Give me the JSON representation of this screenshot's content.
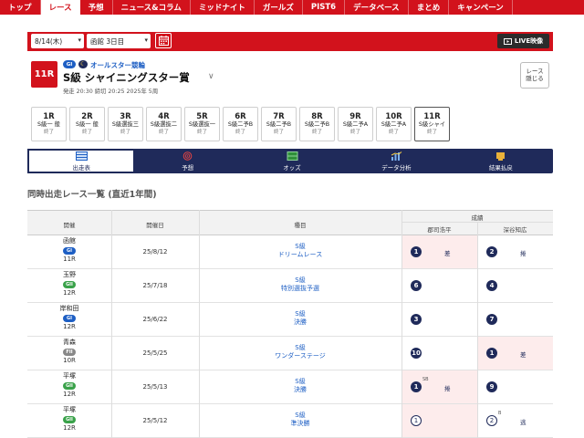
{
  "nav": {
    "items": [
      "トップ",
      "レース",
      "予想",
      "ニュース&コラム",
      "ミッドナイト",
      "ガールズ",
      "PIST6",
      "データベース",
      "まとめ",
      "キャンペーン"
    ],
    "active_index": 1
  },
  "toolbar": {
    "date_value": "8/14(木)",
    "venue_day_value": "函館 3日目",
    "live_label": "LIVE映像"
  },
  "race": {
    "number": "11R",
    "grade": "GI",
    "event": "オールスター競輪",
    "title": "S級 シャイニングスター賞",
    "meta": "発走 20:30 締切 20:25 2025年 5周",
    "hide_label_1": "レース",
    "hide_label_2": "隠じる"
  },
  "race_tabs": [
    {
      "no": "1R",
      "cls": "S級一 般",
      "status": "終了"
    },
    {
      "no": "2R",
      "cls": "S級一 般",
      "status": "終了"
    },
    {
      "no": "3R",
      "cls": "S級選抜三",
      "status": "終了"
    },
    {
      "no": "4R",
      "cls": "S級選抜二",
      "status": "終了"
    },
    {
      "no": "5R",
      "cls": "S級選抜一",
      "status": "終了"
    },
    {
      "no": "6R",
      "cls": "S級二予B",
      "status": "終了"
    },
    {
      "no": "7R",
      "cls": "S級二予B",
      "status": "終了"
    },
    {
      "no": "8R",
      "cls": "S級二予B",
      "status": "終了"
    },
    {
      "no": "9R",
      "cls": "S級二予A",
      "status": "終了"
    },
    {
      "no": "10R",
      "cls": "S級二予A",
      "status": "終了"
    },
    {
      "no": "11R",
      "cls": "S級シャイ",
      "status": "終了"
    }
  ],
  "menu": [
    {
      "label": "出走表",
      "icon": "table-icon"
    },
    {
      "label": "予想",
      "icon": "target-icon"
    },
    {
      "label": "オッズ",
      "icon": "odds-icon"
    },
    {
      "label": "データ分析",
      "icon": "chart-icon"
    },
    {
      "label": "結果払戻",
      "icon": "trophy-icon"
    }
  ],
  "section_title": "同時出走レース一覧 (直近1年間)",
  "table": {
    "headers": {
      "venue": "開催",
      "date": "開催日",
      "event": "種目",
      "results": "成績",
      "rider1": "郡司浩平",
      "rider2": "深谷知広"
    },
    "rows": [
      {
        "venue": "函館",
        "grade": "GI",
        "race": "11R",
        "date": "25/8/12",
        "event1": "S級",
        "event2": "ドリームレース",
        "r1": {
          "pos": "1",
          "type": "filled",
          "kima": "差",
          "sup": ""
        },
        "r2": {
          "pos": "2",
          "type": "filled",
          "kima": "捲",
          "sup": ""
        }
      },
      {
        "venue": "玉野",
        "grade": "GII",
        "race": "12R",
        "date": "25/7/18",
        "event1": "S級",
        "event2": "特別選抜予選",
        "r1": {
          "pos": "6",
          "type": "filled",
          "kima": "",
          "sup": ""
        },
        "r2": {
          "pos": "4",
          "type": "filled",
          "kima": "",
          "sup": ""
        }
      },
      {
        "venue": "岸和田",
        "grade": "GI",
        "race": "12R",
        "date": "25/6/22",
        "event1": "S級",
        "event2": "決勝",
        "r1": {
          "pos": "3",
          "type": "filled",
          "kima": "",
          "sup": ""
        },
        "r2": {
          "pos": "7",
          "type": "filled",
          "kima": "",
          "sup": ""
        }
      },
      {
        "venue": "青森",
        "grade": "FII",
        "race": "10R",
        "date": "25/5/25",
        "event1": "S級",
        "event2": "ワンダーステージ",
        "r1": {
          "pos": "10",
          "type": "filled",
          "kima": "",
          "sup": ""
        },
        "r2": {
          "pos": "1",
          "type": "filled",
          "kima": "差",
          "sup": ""
        }
      },
      {
        "venue": "平塚",
        "grade": "GII",
        "race": "12R",
        "date": "25/5/13",
        "event1": "S級",
        "event2": "決勝",
        "r1": {
          "pos": "1",
          "type": "filled",
          "kima": "捲",
          "sup": "SB"
        },
        "r2": {
          "pos": "9",
          "type": "filled",
          "kima": "",
          "sup": ""
        }
      },
      {
        "venue": "平塚",
        "grade": "GII",
        "race": "12R",
        "date": "25/5/12",
        "event1": "S級",
        "event2": "準決勝",
        "r1": {
          "pos": "1",
          "type": "outline",
          "kima": "",
          "sup": ""
        },
        "r2": {
          "pos": "2",
          "type": "outline",
          "kima": "逃",
          "sup": "B"
        }
      }
    ]
  },
  "colors": {
    "red": "#d2121c",
    "navy": "#1f2a5a",
    "gi": "#1e5fc4",
    "gii": "#3aa24a",
    "fii": "#888888",
    "win_bg": "#fdecec"
  }
}
